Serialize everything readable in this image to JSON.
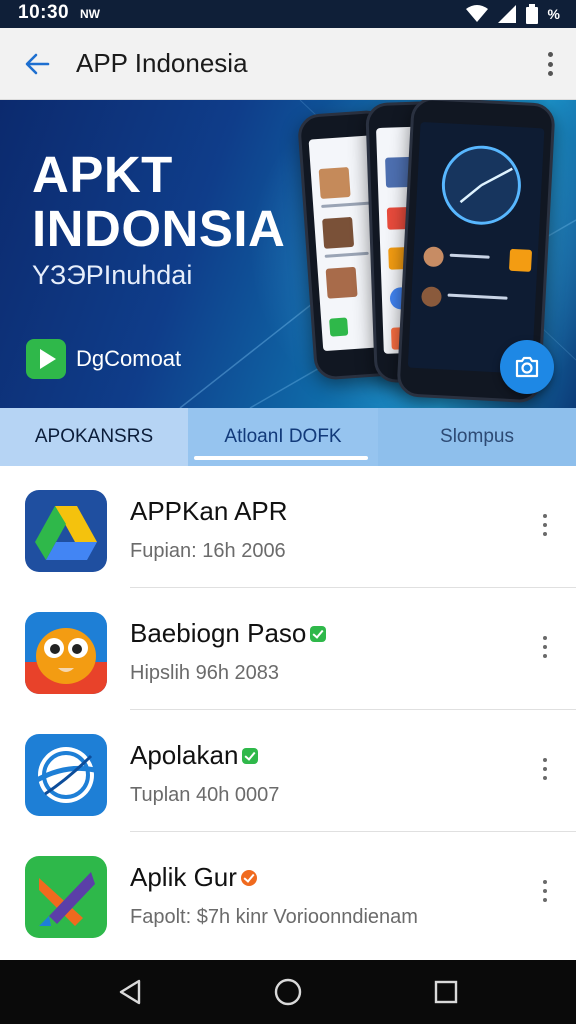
{
  "status_bar": {
    "time": "10:30",
    "carrier": "NW",
    "battery_label": "%",
    "icons": [
      "wifi-icon",
      "signal-icon",
      "battery-icon"
    ]
  },
  "app_bar": {
    "title": "APP Indonesia",
    "back_icon": "arrow-left-icon",
    "menu_icon": "more-vert-icon"
  },
  "banner": {
    "title": "APKT INDONSIA",
    "subtitle": "YЗЭPInuhdai",
    "cta_label": "DgComoat",
    "fab_icon": "camera-icon"
  },
  "tabs": [
    {
      "label": "APOKANSRS"
    },
    {
      "label": "AtloanI DOFK"
    },
    {
      "label": "Slompus"
    }
  ],
  "apps": [
    {
      "title": "APPKan APR",
      "subtitle": "Fupian: 16h 2006",
      "badge": "",
      "icon": "drive-icon"
    },
    {
      "title": "Baebiogn Paso",
      "subtitle": "Hipslih 96h 2083",
      "badge": "green",
      "icon": "owl-icon"
    },
    {
      "title": "Apolakan",
      "subtitle": "Tuplan 40h 0007",
      "badge": "green",
      "icon": "globe-icon"
    },
    {
      "title": "Aplik Gur",
      "subtitle": "Fapolt: $7h kinr Vorioonndienam",
      "badge": "orange",
      "icon": "x-logo-icon"
    }
  ],
  "nav": {
    "icons": [
      "back-triangle-icon",
      "home-circle-icon",
      "recents-square-icon"
    ]
  },
  "colors": {
    "accent": "#1e88e5",
    "banner_dark": "#0c2a6e",
    "tab_bar": "#8fc1ee"
  }
}
